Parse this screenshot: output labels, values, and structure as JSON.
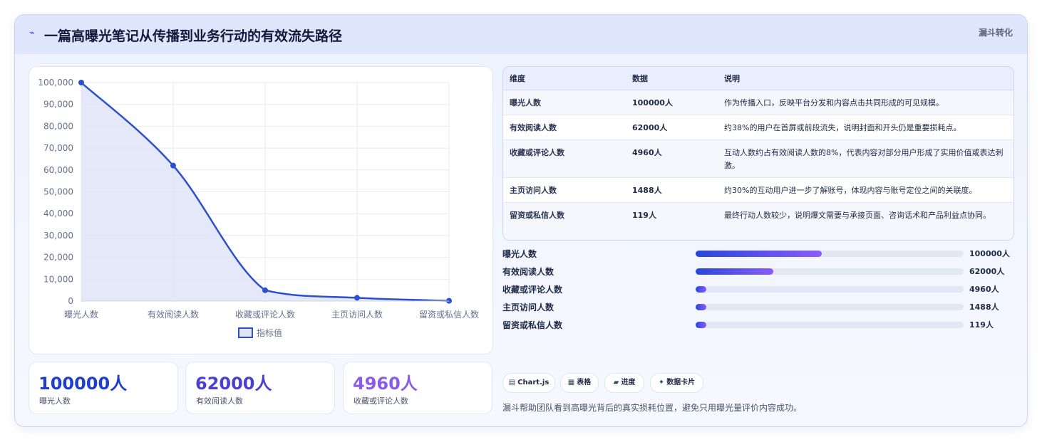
{
  "header": {
    "icon": "lightning-icon",
    "icon_glyph": "⌁",
    "title": "一篇高曝光笔记从传播到业务行动的有效流失路径",
    "tag": "漏斗转化"
  },
  "chart_data": {
    "type": "area",
    "categories": [
      "曝光人数",
      "有效阅读人数",
      "收藏或评论人数",
      "主页访问人数",
      "留资或私信人数"
    ],
    "series": [
      {
        "name": "指标值",
        "values": [
          100000,
          62000,
          4960,
          1488,
          119
        ]
      }
    ],
    "ylim": [
      0,
      100000
    ],
    "yticks": [
      "100,000",
      "90,000",
      "80,000",
      "70,000",
      "60,000",
      "50,000",
      "40,000",
      "30,000",
      "20,000",
      "10,000",
      "0"
    ],
    "grid": true,
    "legend": "bottom",
    "line_color": "#2c4fd0",
    "fill_color": "#dfe4f7"
  },
  "stats": [
    {
      "value": "100000人",
      "label": "曝光人数",
      "color": "#1f3fc9"
    },
    {
      "value": "62000人",
      "label": "有效阅读人数",
      "color": "#4b3fd0"
    },
    {
      "value": "4960人",
      "label": "收藏或评论人数",
      "color": "#8c5ce6"
    }
  ],
  "table": {
    "headers": [
      "维度",
      "数据",
      "说明"
    ],
    "rows": [
      [
        "曝光人数",
        "100000人",
        "作为传播入口，反映平台分发和内容点击共同形成的可见规模。"
      ],
      [
        "有效阅读人数",
        "62000人",
        "约38%的用户在首屏或前段流失，说明封面和开头仍是重要损耗点。"
      ],
      [
        "收藏或评论人数",
        "4960人",
        "互动人数约占有效阅读人数的8%，代表内容对部分用户形成了实用价值或表达刺激。"
      ],
      [
        "主页访问人数",
        "1488人",
        "约30%的互动用户进一步了解账号，体现内容与账号定位之间的关联度。"
      ],
      [
        "留资或私信人数",
        "119人",
        "最终行动人数较少，说明爆文需要与承接页面、咨询话术和产品利益点协同。"
      ]
    ]
  },
  "progress": [
    {
      "label": "曝光人数",
      "value": "100000人",
      "fraction": 0.47
    },
    {
      "label": "有效阅读人数",
      "value": "62000人",
      "fraction": 0.29
    },
    {
      "label": "收藏或评论人数",
      "value": "4960人",
      "fraction": 0.04
    },
    {
      "label": "主页访问人数",
      "value": "1488人",
      "fraction": 0.04
    },
    {
      "label": "留资或私信人数",
      "value": "119人",
      "fraction": 0.04
    }
  ],
  "chips": [
    {
      "icon": "chart-icon",
      "glyph": "▤",
      "label": "Chart.js"
    },
    {
      "icon": "table-icon",
      "glyph": "▦",
      "label": "表格"
    },
    {
      "icon": "progress-icon",
      "glyph": "▰",
      "label": "进度"
    },
    {
      "icon": "sparkle-icon",
      "glyph": "✦",
      "label": "数据卡片"
    }
  ],
  "footnote": "漏斗帮助团队看到高曝光背后的真实损耗位置，避免只用曝光量评价内容成功。"
}
